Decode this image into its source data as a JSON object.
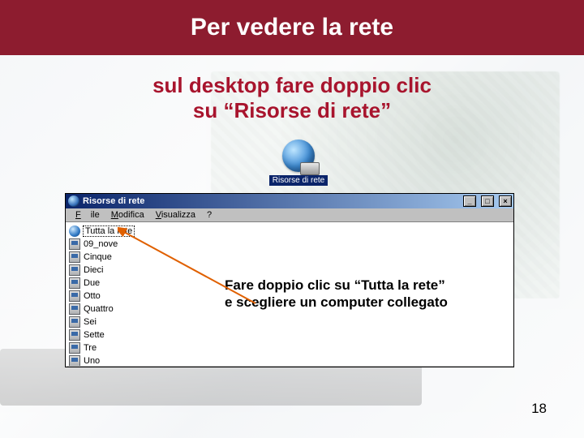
{
  "title": "Per vedere la rete",
  "subtitle_line1": "sul desktop  fare doppio clic",
  "subtitle_line2": "su “Risorse di rete”",
  "desktop_icon_label": "Risorse di rete",
  "window": {
    "title": "Risorse di rete",
    "btn_min": "_",
    "btn_max": "□",
    "btn_close": "×",
    "menu": {
      "file": "File",
      "modifica": "Modifica",
      "visualizza": "Visualizza",
      "help": "?"
    },
    "items": [
      "Tutta la rete",
      "09_nove",
      "Cinque",
      "Dieci",
      "Due",
      "Otto",
      "Quattro",
      "Sei",
      "Sette",
      "Tre",
      "Uno"
    ]
  },
  "callout_line1": "Fare doppio clic su “Tutta la rete”",
  "callout_line2": "e scegliere un computer collegato",
  "page_number": "18"
}
